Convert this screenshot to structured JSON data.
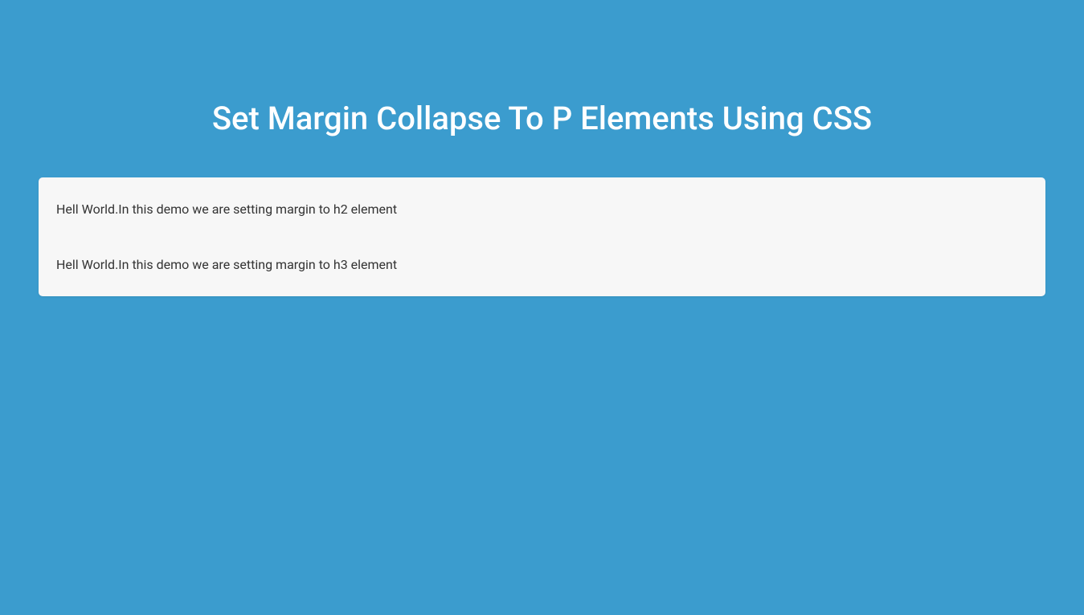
{
  "title": "Set Margin Collapse To P Elements Using CSS",
  "card": {
    "line1": "Hell World.In this demo we are setting margin to h2 element",
    "line2": "Hell World.In this demo we are setting margin to h3 element"
  }
}
